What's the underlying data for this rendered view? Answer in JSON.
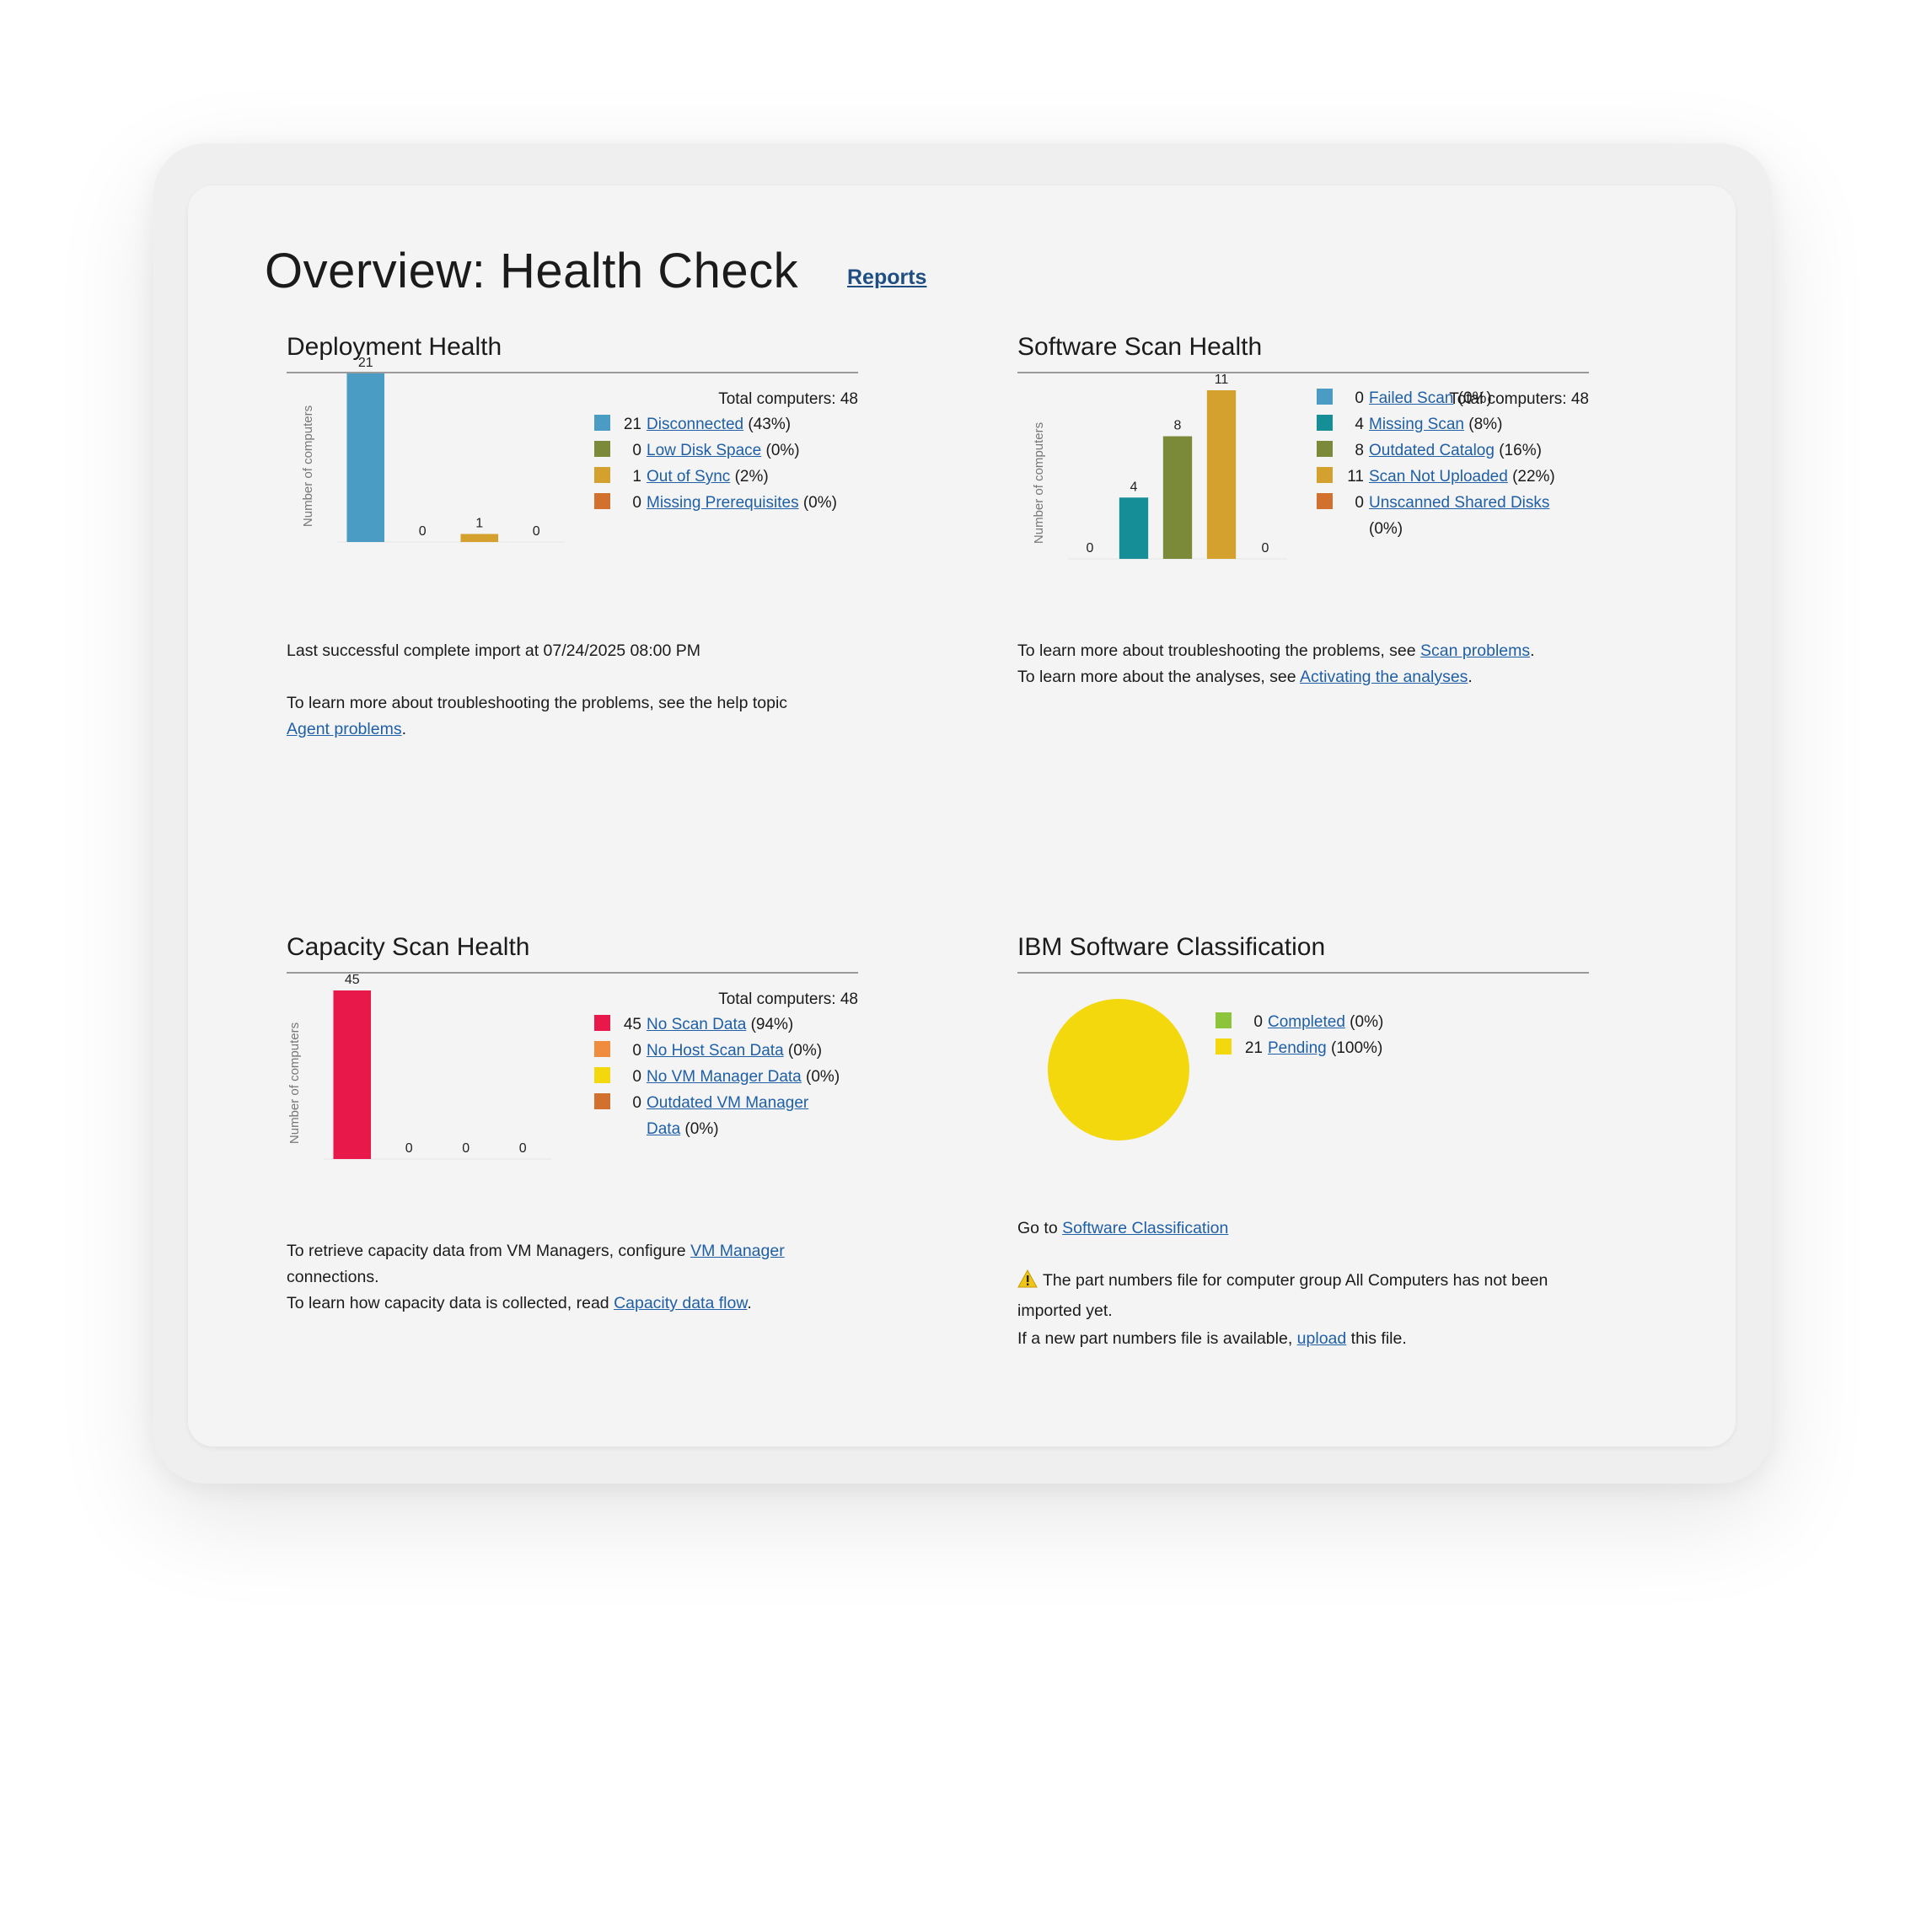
{
  "page": {
    "title": "Overview: Health Check",
    "reports_link": "Reports"
  },
  "deployment": {
    "title": "Deployment Health",
    "total": "Total computers: 48",
    "y_axis_label": "Number of computers",
    "legend": [
      {
        "count": "21",
        "label": "Disconnected",
        "pct": "(43%)",
        "color": "#4a9cc4"
      },
      {
        "count": "0",
        "label": "Low Disk Space",
        "pct": "(0%)",
        "color": "#7a8a38"
      },
      {
        "count": "1",
        "label": "Out of Sync",
        "pct": "(2%)",
        "color": "#d4a02e"
      },
      {
        "count": "0",
        "label": "Missing Prerequisites",
        "pct": "(0%)",
        "color": "#d2702e"
      }
    ],
    "last_import": "Last successful complete import at 07/24/2025 08:00 PM",
    "help_text": "To learn more about troubleshooting the problems, see the help topic",
    "help_link": "Agent problems",
    "help_end": "."
  },
  "software_scan": {
    "title": "Software Scan Health",
    "total": "Total computers: 48",
    "y_axis_label": "Number of computers",
    "legend": [
      {
        "count": "0",
        "label": "Failed Scan",
        "pct": "(0%)",
        "color": "#4a9cc4"
      },
      {
        "count": "4",
        "label": "Missing Scan",
        "pct": "(8%)",
        "color": "#168e98"
      },
      {
        "count": "8",
        "label": "Outdated Catalog",
        "pct": "(16%)",
        "color": "#7a8a38"
      },
      {
        "count": "11",
        "label": "Scan Not Uploaded",
        "pct": "(22%)",
        "color": "#d4a02e"
      },
      {
        "count": "0",
        "label": "Unscanned Shared Disks",
        "pct": "(0%)",
        "color": "#d2702e"
      }
    ],
    "line1_text": "To learn more about troubleshooting the problems, see",
    "line1_link": "Scan problems",
    "line1_end": ".",
    "line2_text": "To learn more about the analyses, see",
    "line2_link": "Activating the analyses",
    "line2_end": "."
  },
  "capacity": {
    "title": "Capacity Scan Health",
    "total": "Total computers: 48",
    "y_axis_label": "Number of computers",
    "legend": [
      {
        "count": "45",
        "label": "No Scan Data",
        "pct": "(94%)",
        "color": "#e8194a"
      },
      {
        "count": "0",
        "label": "No Host Scan Data",
        "pct": "(0%)",
        "color": "#ef8c3e"
      },
      {
        "count": "0",
        "label": "No VM Manager Data",
        "pct": "(0%)",
        "color": "#f2d80c"
      },
      {
        "count": "0",
        "label_1": "Outdated VM Manager",
        "label_2": "Data",
        "pct": "(0%)",
        "color": "#d2702e"
      }
    ],
    "line1_text": "To retrieve capacity data from VM Managers, configure",
    "line1_link": "VM Manager",
    "line1_tail": "connections.",
    "line2_text": "To learn how capacity data is collected, read",
    "line2_link": "Capacity data flow",
    "line2_end": "."
  },
  "classification": {
    "title": "IBM Software Classification",
    "legend": [
      {
        "count": "0",
        "label": "Completed",
        "pct": "(0%)",
        "color": "#8cc43c"
      },
      {
        "count": "21",
        "label": "Pending",
        "pct": "(100%)",
        "color": "#f2d80c"
      }
    ],
    "goto_text": "Go to",
    "goto_link": "Software Classification",
    "warning_text": "The part numbers file for computer group All Computers has not been imported yet.",
    "upload_text": "If a new part numbers file is available,",
    "upload_link": "upload",
    "upload_end": "this file."
  },
  "chart_data": [
    {
      "type": "bar",
      "title": "Deployment Health",
      "ylabel": "Number of computers",
      "categories": [
        "Disconnected",
        "Low Disk Space",
        "Out of Sync",
        "Missing Prerequisites"
      ],
      "values": [
        21,
        0,
        1,
        0
      ],
      "colors": [
        "#4a9cc4",
        "#7a8a38",
        "#d4a02e",
        "#d2702e"
      ],
      "legend": "right"
    },
    {
      "type": "bar",
      "title": "Software Scan Health",
      "ylabel": "Number of computers",
      "categories": [
        "Failed Scan",
        "Missing Scan",
        "Outdated Catalog",
        "Scan Not Uploaded",
        "Unscanned Shared Disks"
      ],
      "values": [
        0,
        4,
        8,
        11,
        0
      ],
      "colors": [
        "#4a9cc4",
        "#168e98",
        "#7a8a38",
        "#d4a02e",
        "#d2702e"
      ],
      "legend": "right"
    },
    {
      "type": "bar",
      "title": "Capacity Scan Health",
      "ylabel": "Number of computers",
      "categories": [
        "No Scan Data",
        "No Host Scan Data",
        "No VM Manager Data",
        "Outdated VM Manager Data"
      ],
      "values": [
        45,
        0,
        0,
        0
      ],
      "colors": [
        "#e8194a",
        "#ef8c3e",
        "#f2d80c",
        "#d2702e"
      ],
      "legend": "right"
    },
    {
      "type": "pie",
      "title": "IBM Software Classification",
      "categories": [
        "Completed",
        "Pending"
      ],
      "values": [
        0,
        21
      ],
      "colors": [
        "#8cc43c",
        "#f2d80c"
      ],
      "legend": "right"
    }
  ]
}
